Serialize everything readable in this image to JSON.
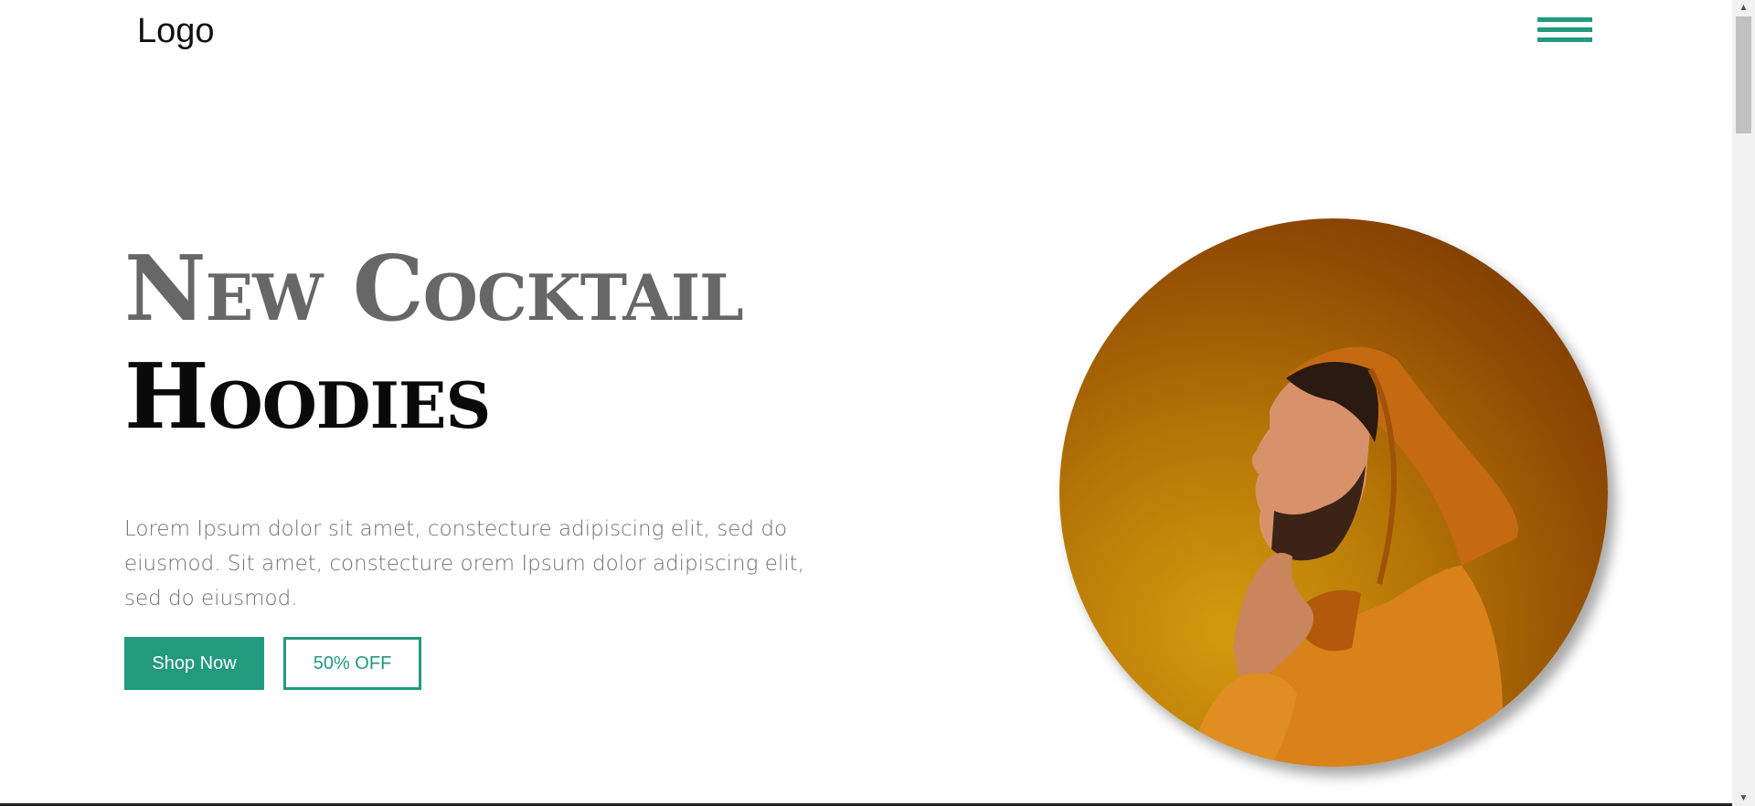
{
  "header": {
    "logo_text": "Logo",
    "menu_icon": "hamburger-menu-icon"
  },
  "hero": {
    "title_line1": "New Cocktail",
    "title_line2": "Hoodies",
    "description": "Lorem Ipsum dolor sit amet, constecture adipiscing elit, sed do eiusmod. Sit amet, constecture orem Ipsum dolor adipiscing elit, sed do eiusmod.",
    "primary_button": "Shop Now",
    "secondary_button": "50% OFF",
    "image_alt": "Man in orange hoodie"
  },
  "colors": {
    "accent": "#219a7e",
    "title_gray": "#676767",
    "title_dark": "#0a0a0a",
    "text_gray": "#707070"
  },
  "scrollbar": {
    "up_icon": "scroll-up-arrow-icon",
    "down_icon": "scroll-down-arrow-icon"
  }
}
